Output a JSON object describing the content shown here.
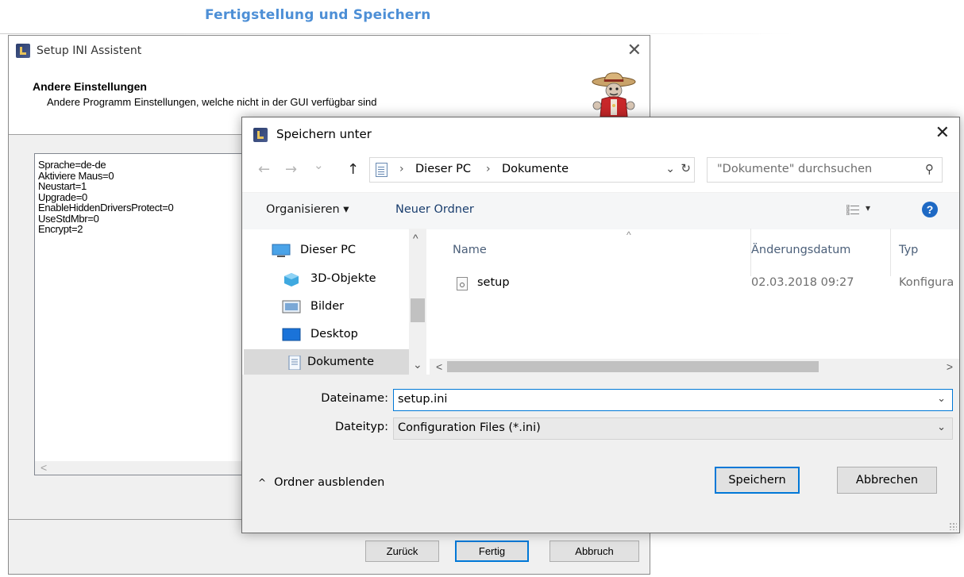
{
  "caption": "Fertigstellung und Speichern",
  "back_window": {
    "title": "Setup INI Assistent",
    "close": "✕",
    "header_title": "Andere Einstellungen",
    "header_subtitle": "Andere Programm Einstellungen, welche nicht in der GUI verfügbar sind",
    "ini_lines": [
      "Sprache=de-de",
      "Aktiviere Maus=0",
      "Neustart=1",
      "Upgrade=0",
      "EnableHiddenDriversProtect=0",
      "UseStdMbr=0",
      "Encrypt=2"
    ],
    "scroll_left": "<",
    "buttons": {
      "back": "Zurück",
      "finish": "Fertig",
      "cancel": "Abbruch"
    }
  },
  "dialog": {
    "title": "Speichern unter",
    "close": "✕",
    "nav": {
      "back": "←",
      "forward": "→",
      "recent": "⌄",
      "up": "↑"
    },
    "breadcrumb": [
      "Dieser PC",
      "Dokumente"
    ],
    "breadcrumb_sep": "›",
    "address_dropdown": "⌄",
    "refresh": "↻",
    "search_placeholder": "\"Dokumente\" durchsuchen",
    "search_glyph": "⚲",
    "toolbar": {
      "organize": "Organisieren ▾",
      "new_folder": "Neuer Ordner",
      "view_dropdown": "▾",
      "help": "?"
    },
    "nav_items": [
      "Dieser PC",
      "3D-Objekte",
      "Bilder",
      "Desktop",
      "Dokumente"
    ],
    "columns": {
      "name": "Name",
      "date": "Änderungsdatum",
      "type": "Typ"
    },
    "files": [
      {
        "name": "setup",
        "date": "02.03.2018 09:27",
        "type": "Konfigura"
      }
    ],
    "filename_label": "Dateiname:",
    "filename_value": "setup.ini",
    "filetype_label": "Dateityp:",
    "filetype_value": "Configuration Files (*.ini)",
    "collapse": "Ordner ausblenden",
    "buttons": {
      "save": "Speichern",
      "cancel": "Abbrechen"
    }
  },
  "colors": {
    "accent": "#0078d7",
    "caption": "#4d8fd6",
    "help": "#1e69c4"
  }
}
